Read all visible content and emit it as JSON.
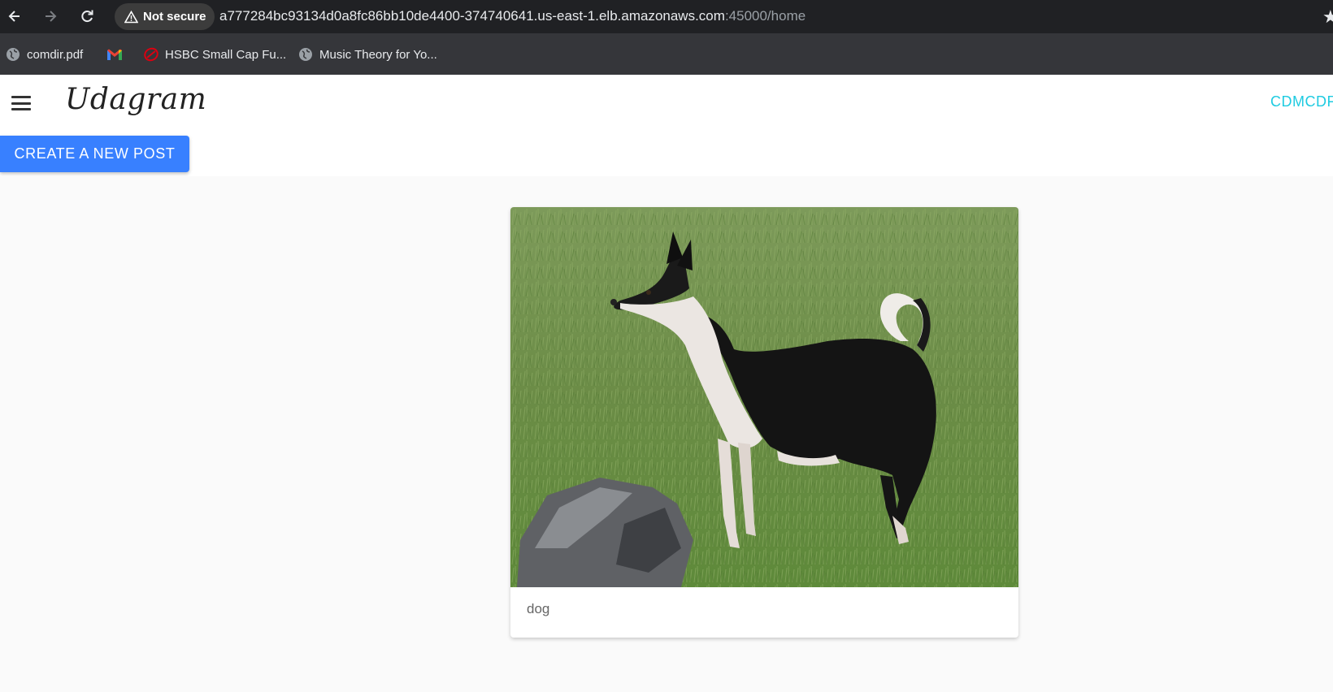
{
  "browser": {
    "security_label": "Not secure",
    "url_main": "a777284bc93134d0a8fc86bb10de4400-374740641.us-east-1.elb.amazonaws.com",
    "url_rest": ":45000/home",
    "bookmarks": [
      {
        "label": "comdir.pdf",
        "icon": "globe-icon"
      },
      {
        "label": "",
        "icon": "gmail-icon"
      },
      {
        "label": "HSBC Small Cap Fu...",
        "icon": "hsbc-icon"
      },
      {
        "label": "Music Theory for Yo...",
        "icon": "globe-icon"
      }
    ]
  },
  "app": {
    "brand": "Udagram",
    "user_label": "CDMCDF",
    "create_button": "CREATE A NEW POST",
    "accent_color": "#3880ff",
    "user_color": "#1ecbe1"
  },
  "feed": {
    "posts": [
      {
        "caption": "dog",
        "image": "black-and-white-dog-standing-on-grass-next-to-rock"
      }
    ]
  }
}
